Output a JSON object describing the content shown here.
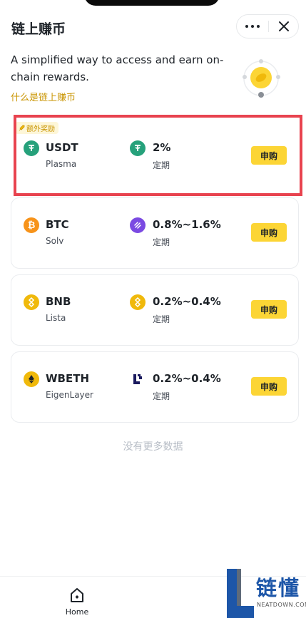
{
  "header": {
    "title": "链上赚币"
  },
  "intro": {
    "description": "A simplified way to access and earn on-chain rewards.",
    "link": "什么是链上赚币"
  },
  "badge": "额外奖励",
  "products": [
    {
      "symbol": "USDT",
      "protocol": "Plasma",
      "rate": "2%",
      "term": "定期",
      "action": "申购",
      "coin_icon": "usdt-icon",
      "reward_icon": "usdt-icon"
    },
    {
      "symbol": "BTC",
      "protocol": "Solv",
      "rate": "0.8%~1.6%",
      "term": "定期",
      "action": "申购",
      "coin_icon": "btc-icon",
      "reward_icon": "solv-icon"
    },
    {
      "symbol": "BNB",
      "protocol": "Lista",
      "rate": "0.2%~0.4%",
      "term": "定期",
      "action": "申购",
      "coin_icon": "bnb-icon",
      "reward_icon": "bnb-icon"
    },
    {
      "symbol": "WBETH",
      "protocol": "EigenLayer",
      "rate": "0.2%~0.4%",
      "term": "定期",
      "action": "申购",
      "coin_icon": "eth-icon",
      "reward_icon": "eigenlayer-icon"
    }
  ],
  "footer_note": "没有更多数据",
  "tabbar": {
    "home_label": "Home"
  },
  "watermark": {
    "zh": "链懂",
    "en": "NEATDOWN.COM"
  },
  "colors": {
    "accent": "#fcd535",
    "link": "#c99400",
    "highlight": "#e8434f",
    "usdt": "#26a17b",
    "btc": "#f7931a",
    "bnb": "#f0b90b"
  }
}
